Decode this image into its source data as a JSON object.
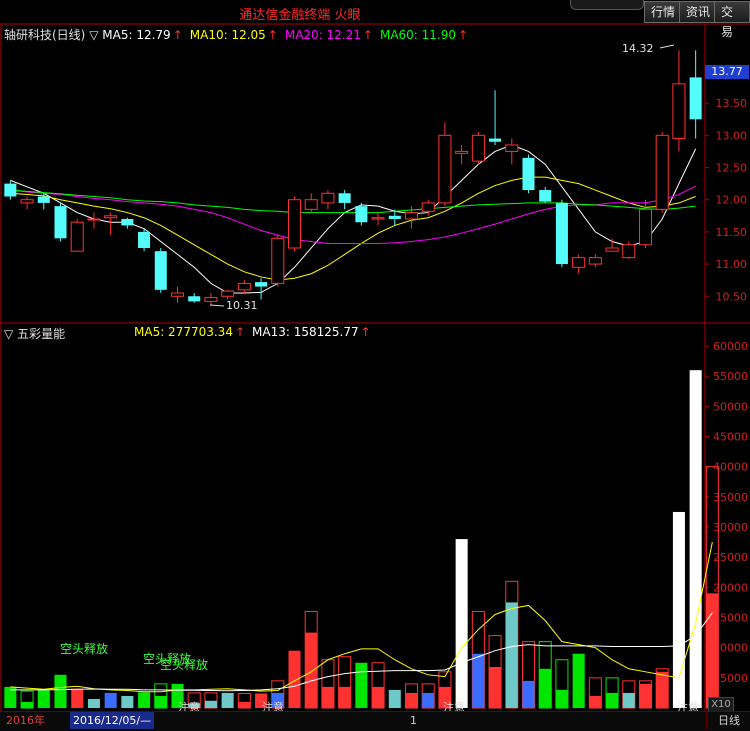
{
  "window": {
    "title": "通达信金融终端 火眼",
    "buttons": [
      "行情",
      "资讯",
      "交易"
    ]
  },
  "colors": {
    "up": "#ff3232",
    "down": "#54fcfc",
    "ma5": "#ffffff",
    "ma10": "#ffff00",
    "ma20": "#ff00ff",
    "ma60": "#00ff00",
    "axis": "#b00000",
    "vol_green": "#00e600",
    "vol_blue": "#3a6cff",
    "vol_teal": "#6fc8c8",
    "vol_white": "#ffffff"
  },
  "price_panel": {
    "name": "轴研科技(日线)",
    "indicators": [
      {
        "label": "MA5: 12.79",
        "color": "#ffffff"
      },
      {
        "label": "MA10: 12.05",
        "color": "#ffff00"
      },
      {
        "label": "MA20: 12.21",
        "color": "#ff00ff"
      },
      {
        "label": "MA60: 11.90",
        "color": "#00ff00"
      }
    ],
    "current_price": "13.77",
    "high_annotation": "14.32",
    "low_annotation": "10.31"
  },
  "volume_panel": {
    "name": "五彩量能",
    "indicators": [
      {
        "label": "MA5: 277703.34",
        "color": "#ffff00"
      },
      {
        "label": "MA13: 158125.77",
        "color": "#ffffff"
      }
    ],
    "multiplier": "X10",
    "annotations": [
      "空头释放",
      "空头释放",
      "空头释放",
      "注意",
      "注意",
      "注意",
      "注意"
    ]
  },
  "bottom_bar": {
    "year": "2016年",
    "date": "2016/12/05/—",
    "marker": "1",
    "period": "日线"
  },
  "chart_data": [
    {
      "type": "candlestick",
      "title": "轴研科技(日线)",
      "ylim": [
        10.1,
        14.45
      ],
      "y_ticks": [
        "14.00",
        "13.50",
        "13.00",
        "12.50",
        "12.00",
        "11.50",
        "11.00",
        "10.50"
      ],
      "candles": [
        {
          "open": 12.25,
          "high": 12.3,
          "low": 12.0,
          "close": 12.05
        },
        {
          "open": 11.95,
          "high": 12.05,
          "low": 11.85,
          "close": 12.0
        },
        {
          "open": 12.05,
          "high": 12.1,
          "low": 11.85,
          "close": 11.95
        },
        {
          "open": 11.9,
          "high": 11.95,
          "low": 11.35,
          "close": 11.4
        },
        {
          "open": 11.2,
          "high": 11.7,
          "low": 11.2,
          "close": 11.65
        },
        {
          "open": 11.7,
          "high": 11.8,
          "low": 11.55,
          "close": 11.7
        },
        {
          "open": 11.72,
          "high": 11.8,
          "low": 11.45,
          "close": 11.75
        },
        {
          "open": 11.7,
          "high": 11.72,
          "low": 11.55,
          "close": 11.6
        },
        {
          "open": 11.5,
          "high": 11.55,
          "low": 11.2,
          "close": 11.25
        },
        {
          "open": 11.2,
          "high": 11.25,
          "low": 10.55,
          "close": 10.6
        },
        {
          "open": 10.5,
          "high": 10.65,
          "low": 10.4,
          "close": 10.55
        },
        {
          "open": 10.5,
          "high": 10.55,
          "low": 10.4,
          "close": 10.42
        },
        {
          "open": 10.42,
          "high": 10.55,
          "low": 10.35,
          "close": 10.48
        },
        {
          "open": 10.5,
          "high": 10.6,
          "low": 10.45,
          "close": 10.58
        },
        {
          "open": 10.6,
          "high": 10.75,
          "low": 10.55,
          "close": 10.7
        },
        {
          "open": 10.72,
          "high": 10.78,
          "low": 10.45,
          "close": 10.65
        },
        {
          "open": 10.7,
          "high": 11.45,
          "low": 10.65,
          "close": 11.4
        },
        {
          "open": 11.25,
          "high": 12.05,
          "low": 11.2,
          "close": 12.0
        },
        {
          "open": 11.85,
          "high": 12.1,
          "low": 11.8,
          "close": 12.0
        },
        {
          "open": 11.95,
          "high": 12.15,
          "low": 11.85,
          "close": 12.1
        },
        {
          "open": 12.1,
          "high": 12.15,
          "low": 11.85,
          "close": 11.95
        },
        {
          "open": 11.9,
          "high": 11.95,
          "low": 11.6,
          "close": 11.65
        },
        {
          "open": 11.7,
          "high": 11.8,
          "low": 11.6,
          "close": 11.72
        },
        {
          "open": 11.75,
          "high": 11.85,
          "low": 11.6,
          "close": 11.7
        },
        {
          "open": 11.7,
          "high": 11.9,
          "low": 11.55,
          "close": 11.8
        },
        {
          "open": 11.82,
          "high": 12.0,
          "low": 11.75,
          "close": 11.95
        },
        {
          "open": 11.95,
          "high": 13.2,
          "low": 11.9,
          "close": 13.0
        },
        {
          "open": 12.72,
          "high": 12.85,
          "low": 12.55,
          "close": 12.75
        },
        {
          "open": 12.6,
          "high": 13.05,
          "low": 12.55,
          "close": 13.0
        },
        {
          "open": 12.95,
          "high": 13.7,
          "low": 12.85,
          "close": 12.9
        },
        {
          "open": 12.75,
          "high": 12.95,
          "low": 12.55,
          "close": 12.85
        },
        {
          "open": 12.65,
          "high": 12.7,
          "low": 12.1,
          "close": 12.15
        },
        {
          "open": 12.15,
          "high": 12.2,
          "low": 11.95,
          "close": 11.97
        },
        {
          "open": 11.95,
          "high": 12.0,
          "low": 10.95,
          "close": 11.0
        },
        {
          "open": 10.95,
          "high": 11.15,
          "low": 10.85,
          "close": 11.1
        },
        {
          "open": 11.0,
          "high": 11.15,
          "low": 10.95,
          "close": 11.1
        },
        {
          "open": 11.2,
          "high": 11.4,
          "low": 11.2,
          "close": 11.25
        },
        {
          "open": 11.1,
          "high": 11.35,
          "low": 11.08,
          "close": 11.3
        },
        {
          "open": 11.3,
          "high": 12.0,
          "low": 11.25,
          "close": 11.85
        },
        {
          "open": 11.85,
          "high": 13.05,
          "low": 11.8,
          "close": 13.0
        },
        {
          "open": 12.95,
          "high": 14.32,
          "low": 12.75,
          "close": 13.8
        },
        {
          "open": 13.9,
          "high": 14.32,
          "low": 12.95,
          "close": 13.25
        }
      ],
      "series": [
        {
          "name": "MA5",
          "values": [
            12.3,
            12.2,
            12.1,
            11.95,
            11.8,
            11.7,
            11.65,
            11.65,
            11.55,
            11.35,
            11.15,
            10.95,
            10.7,
            10.55,
            10.55,
            10.56,
            10.7,
            10.95,
            11.25,
            11.55,
            11.8,
            11.92,
            11.9,
            11.82,
            11.78,
            11.8,
            12.05,
            12.3,
            12.55,
            12.75,
            12.85,
            12.75,
            12.55,
            12.2,
            11.85,
            11.5,
            11.35,
            11.28,
            11.35,
            11.7,
            12.25,
            12.79
          ]
        },
        {
          "name": "MA10",
          "values": [
            12.1,
            12.08,
            12.06,
            12.0,
            11.95,
            11.9,
            11.86,
            11.8,
            11.72,
            11.6,
            11.45,
            11.3,
            11.15,
            11.0,
            10.88,
            10.8,
            10.75,
            10.78,
            10.85,
            10.98,
            11.15,
            11.32,
            11.48,
            11.6,
            11.68,
            11.72,
            11.82,
            11.95,
            12.1,
            12.22,
            12.3,
            12.35,
            12.35,
            12.3,
            12.25,
            12.15,
            12.05,
            11.95,
            11.88,
            11.9,
            11.95,
            12.05
          ]
        },
        {
          "name": "MA20",
          "values": [
            12.15,
            12.12,
            12.1,
            12.08,
            12.05,
            12.02,
            12.0,
            11.97,
            11.95,
            11.93,
            11.9,
            11.85,
            11.8,
            11.72,
            11.62,
            11.52,
            11.45,
            11.38,
            11.35,
            11.32,
            11.32,
            11.32,
            11.32,
            11.33,
            11.35,
            11.38,
            11.42,
            11.48,
            11.55,
            11.62,
            11.7,
            11.78,
            11.85,
            11.9,
            11.92,
            11.92,
            11.95,
            11.95,
            11.95,
            12.0,
            12.08,
            12.21
          ]
        },
        {
          "name": "MA60",
          "values": [
            12.15,
            12.13,
            12.11,
            12.09,
            12.07,
            12.05,
            12.03,
            12.0,
            11.98,
            11.97,
            11.95,
            11.92,
            11.9,
            11.88,
            11.85,
            11.83,
            11.82,
            11.8,
            11.8,
            11.8,
            11.8,
            11.8,
            11.8,
            11.82,
            11.84,
            11.86,
            11.88,
            11.9,
            11.92,
            11.93,
            11.94,
            11.95,
            11.95,
            11.95,
            11.93,
            11.92,
            11.9,
            11.88,
            11.86,
            11.85,
            11.87,
            11.9
          ]
        }
      ]
    },
    {
      "type": "bar",
      "title": "五彩量能",
      "ylim": [
        0,
        61500
      ],
      "y_ticks": [
        "60000",
        "55000",
        "50000",
        "45000",
        "40000",
        "35000",
        "30000",
        "25000",
        "20000",
        "15000",
        "10000",
        "5000"
      ],
      "bars": [
        {
          "value": 3500,
          "color": "green",
          "hollow": false,
          "inner": 0
        },
        {
          "value": 2800,
          "color": "green",
          "hollow": true,
          "inner": 1000
        },
        {
          "value": 3000,
          "color": "green",
          "hollow": false,
          "inner": 0
        },
        {
          "value": 5500,
          "color": "green",
          "hollow": false,
          "inner": 0
        },
        {
          "value": 3200,
          "color": "red",
          "hollow": false,
          "inner": 0
        },
        {
          "value": 1500,
          "color": "teal",
          "hollow": false,
          "inner": 0
        },
        {
          "value": 2500,
          "color": "blue",
          "hollow": false,
          "inner": 0
        },
        {
          "value": 2000,
          "color": "teal",
          "hollow": false,
          "inner": 0
        },
        {
          "value": 2600,
          "color": "green",
          "hollow": false,
          "inner": 0
        },
        {
          "value": 4000,
          "color": "green",
          "hollow": true,
          "inner": 2000
        },
        {
          "value": 4000,
          "color": "green",
          "hollow": false,
          "inner": 0
        },
        {
          "value": 2500,
          "color": "teal",
          "hollow": true,
          "inner": 800
        },
        {
          "value": 2500,
          "color": "teal",
          "hollow": true,
          "inner": 1200
        },
        {
          "value": 2500,
          "color": "teal",
          "hollow": false,
          "inner": 0
        },
        {
          "value": 2400,
          "color": "red",
          "hollow": true,
          "inner": 1000
        },
        {
          "value": 2400,
          "color": "red",
          "hollow": false,
          "inner": 0
        },
        {
          "value": 4500,
          "color": "blue",
          "hollow": true,
          "inner": 2500
        },
        {
          "value": 9500,
          "color": "red",
          "hollow": false,
          "inner": 0
        },
        {
          "value": 16000,
          "color": "red",
          "hollow": true,
          "inner": 12500
        },
        {
          "value": 8000,
          "color": "red",
          "hollow": true,
          "inner": 3500
        },
        {
          "value": 8500,
          "color": "red",
          "hollow": true,
          "inner": 3500
        },
        {
          "value": 7500,
          "color": "green",
          "hollow": false,
          "inner": 0
        },
        {
          "value": 7500,
          "color": "red",
          "hollow": true,
          "inner": 3500
        },
        {
          "value": 3000,
          "color": "teal",
          "hollow": false,
          "inner": 0
        },
        {
          "value": 4000,
          "color": "red",
          "hollow": true,
          "inner": 2500
        },
        {
          "value": 4000,
          "color": "blue",
          "hollow": true,
          "inner": 2500
        },
        {
          "value": 6000,
          "color": "red",
          "hollow": true,
          "inner": 3500
        },
        {
          "value": 28000,
          "color": "white",
          "hollow": false,
          "inner": 0
        },
        {
          "value": 16000,
          "color": "blue",
          "hollow": true,
          "inner": 9000
        },
        {
          "value": 12000,
          "color": "red",
          "hollow": true,
          "inner": 6800
        },
        {
          "value": 21000,
          "color": "teal",
          "hollow": true,
          "inner": 17500
        },
        {
          "value": 11000,
          "color": "blue",
          "hollow": true,
          "inner": 4500
        },
        {
          "value": 11000,
          "color": "green",
          "hollow": true,
          "inner": 6500
        },
        {
          "value": 8000,
          "color": "green",
          "hollow": true,
          "inner": 3000
        },
        {
          "value": 9000,
          "color": "green",
          "hollow": false,
          "inner": 0
        },
        {
          "value": 5000,
          "color": "red",
          "hollow": true,
          "inner": 2000
        },
        {
          "value": 5000,
          "color": "green",
          "hollow": true,
          "inner": 2500
        },
        {
          "value": 4500,
          "color": "teal",
          "hollow": true,
          "inner": 2500
        },
        {
          "value": 4500,
          "color": "red",
          "hollow": true,
          "inner": 4000
        },
        {
          "value": 6500,
          "color": "red",
          "hollow": true,
          "inner": 6000
        },
        {
          "value": 32500,
          "color": "white",
          "hollow": false,
          "inner": 0
        },
        {
          "value": 56000,
          "color": "white",
          "hollow": false,
          "inner": 0
        },
        {
          "value": 40000,
          "color": "red",
          "hollow": true,
          "inner": 19000
        }
      ],
      "series": [
        {
          "name": "MA5",
          "values": [
            3500,
            3300,
            3100,
            3400,
            3600,
            3200,
            3000,
            2900,
            2700,
            2700,
            3000,
            3000,
            3100,
            3200,
            3000,
            2800,
            2900,
            4500,
            6000,
            8000,
            9000,
            9800,
            9800,
            8000,
            6500,
            5500,
            5200,
            10000,
            13000,
            15500,
            16500,
            17000,
            14500,
            11000,
            10500,
            10000,
            8000,
            6500,
            6000,
            5500,
            5000,
            14000,
            27500
          ]
        },
        {
          "name": "MA13",
          "values": [
            3000,
            3000,
            3000,
            3050,
            3100,
            3150,
            3100,
            3100,
            3000,
            3000,
            2950,
            2950,
            2900,
            2850,
            2900,
            3000,
            3200,
            3600,
            4500,
            5200,
            5700,
            6000,
            6100,
            6200,
            6200,
            6200,
            6300,
            7500,
            8500,
            9500,
            10200,
            10500,
            10300,
            10300,
            10300,
            10300,
            10200,
            10200,
            10200,
            10200,
            10300,
            12000,
            15800
          ]
        }
      ]
    }
  ]
}
